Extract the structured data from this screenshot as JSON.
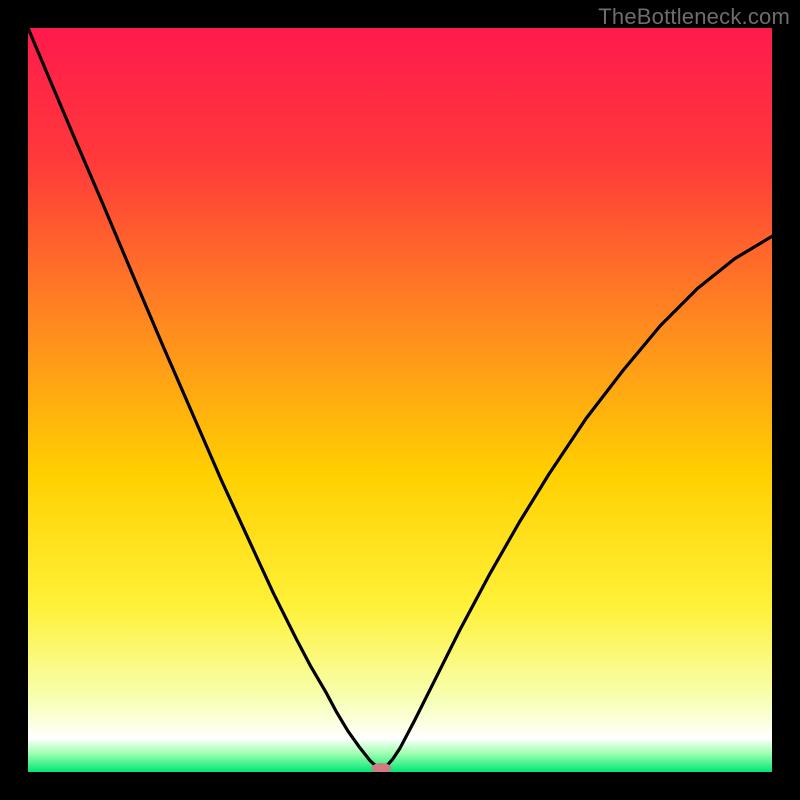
{
  "watermark": "TheBottleneck.com",
  "chart_data": {
    "type": "line",
    "title": "",
    "xlabel": "",
    "ylabel": "",
    "xlim": [
      0,
      100
    ],
    "ylim": [
      0,
      100
    ],
    "background_gradient_stops": [
      {
        "offset": 0.0,
        "color": "#ff1a4d"
      },
      {
        "offset": 0.18,
        "color": "#ff3a3a"
      },
      {
        "offset": 0.4,
        "color": "#ff8a1f"
      },
      {
        "offset": 0.6,
        "color": "#ffd000"
      },
      {
        "offset": 0.78,
        "color": "#fff23a"
      },
      {
        "offset": 0.9,
        "color": "#f7ffb0"
      },
      {
        "offset": 0.955,
        "color": "#ffffff"
      },
      {
        "offset": 0.975,
        "color": "#9fffb0"
      },
      {
        "offset": 1.0,
        "color": "#00e676"
      }
    ],
    "series": [
      {
        "name": "bottleneck-curve",
        "x": [
          0.0,
          3.0,
          6.0,
          10.0,
          14.0,
          18.0,
          22.0,
          26.0,
          30.0,
          33.0,
          36.0,
          38.0,
          40.0,
          41.5,
          43.0,
          44.5,
          46.0,
          47.0,
          48.0,
          49.0,
          50.0,
          52.0,
          55.0,
          58.0,
          62.0,
          66.0,
          70.0,
          75.0,
          80.0,
          85.0,
          90.0,
          95.0,
          100.0
        ],
        "values": [
          100.0,
          92.9,
          85.8,
          76.5,
          67.0,
          57.6,
          48.4,
          39.2,
          30.5,
          24.0,
          18.0,
          14.2,
          10.8,
          8.0,
          5.5,
          3.4,
          1.5,
          0.6,
          0.6,
          1.7,
          3.2,
          7.0,
          13.0,
          19.0,
          26.5,
          33.5,
          40.0,
          47.5,
          54.0,
          60.0,
          65.0,
          69.0,
          72.0
        ]
      }
    ],
    "marker": {
      "name": "optimum-marker",
      "x": 47.5,
      "y": 0.0,
      "color": "#cf7d80",
      "rx": 10,
      "ry": 5
    },
    "notes": "V-shaped bottleneck curve over vertical rainbow gradient; minimum near x≈47.5 at y≈0. Values estimated from pixel positions."
  }
}
